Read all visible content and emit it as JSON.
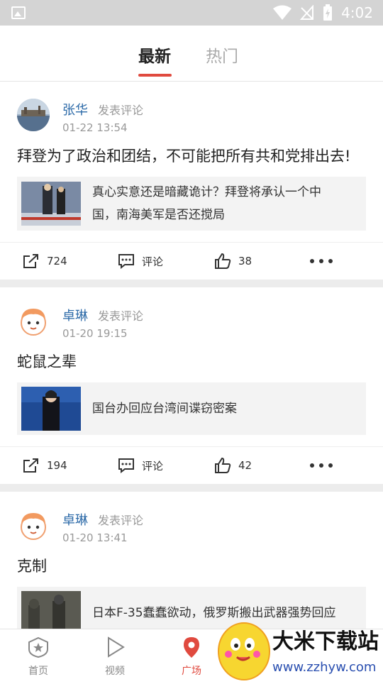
{
  "status_bar": {
    "time": "4:02"
  },
  "tabs": [
    {
      "label": "最新",
      "active": true
    },
    {
      "label": "热门",
      "active": false
    }
  ],
  "posts": [
    {
      "author": "张华",
      "action": "发表评论",
      "time": "01-22 13:54",
      "content": "拜登为了政治和团结，不可能把所有共和党排出去!",
      "article_title_1": "真心实意还是暗藏诡计？拜登将承认一个中",
      "article_title_2": "国，南海美军是否还搅局",
      "share_count": "724",
      "comment_label": "评论",
      "like_count": "38"
    },
    {
      "author": "卓琳",
      "action": "发表评论",
      "time": "01-20 19:15",
      "content": "蛇鼠之辈",
      "article_title_1": "国台办回应台湾间谍窃密案",
      "article_title_2": "",
      "share_count": "194",
      "comment_label": "评论",
      "like_count": "42"
    },
    {
      "author": "卓琳",
      "action": "发表评论",
      "time": "01-20 13:41",
      "content": "克制",
      "article_title_1": "日本F-35蠢蠢欲动，俄罗斯搬出武器强势回应",
      "article_title_2": ""
    }
  ],
  "bottom_nav": [
    {
      "label": "首页",
      "icon": "home-badge-icon"
    },
    {
      "label": "视频",
      "icon": "play-icon"
    },
    {
      "label": "广场",
      "icon": "location-pin-icon",
      "active": true
    }
  ],
  "watermark": {
    "brand": "大米下载站",
    "url": "www.zzhyw.com"
  },
  "colors": {
    "accent": "#e04a3f",
    "author": "#2c6aa8"
  }
}
